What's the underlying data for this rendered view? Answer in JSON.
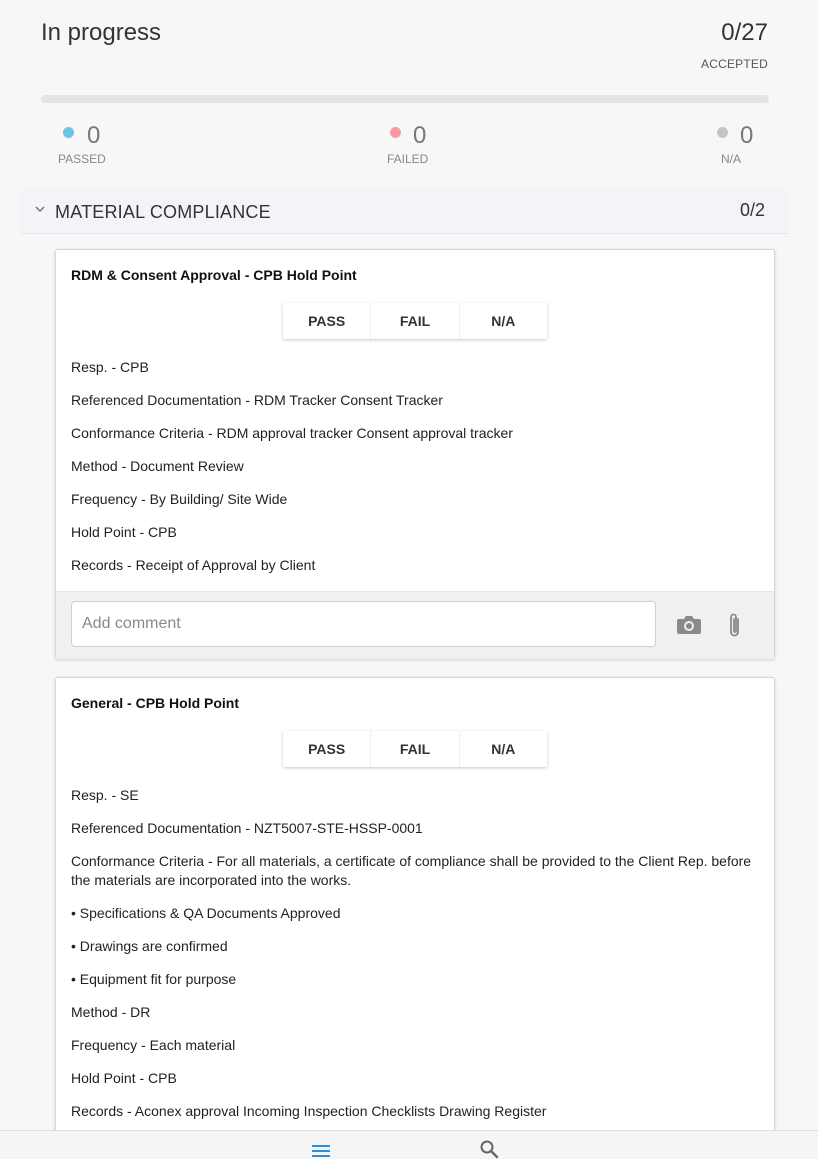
{
  "header": {
    "title": "In progress",
    "count": "0/27",
    "count_label": "ACCEPTED",
    "progress_fraction": 0
  },
  "stats": {
    "passed": {
      "value": "0",
      "label": "PASSED",
      "color": "#6cc3e8"
    },
    "failed": {
      "value": "0",
      "label": "FAILED",
      "color": "#f49aa3"
    },
    "na": {
      "value": "0",
      "label": "N/A",
      "color": "#c4c4c4"
    }
  },
  "section": {
    "title": "MATERIAL COMPLIANCE",
    "count": "0/2",
    "chevron_icon": "chevron-down-icon"
  },
  "buttons": {
    "pass": "PASS",
    "fail": "FAIL",
    "na": "N/A"
  },
  "cards": [
    {
      "title": "RDM & Consent Approval - CPB Hold Point",
      "lines": [
        "Resp. - CPB",
        "Referenced Documentation - RDM Tracker Consent Tracker",
        "Conformance Criteria - RDM approval tracker Consent approval tracker",
        "Method - Document Review",
        "Frequency - By Building/ Site Wide",
        "Hold Point - CPB",
        "Records - Receipt of Approval by Client"
      ],
      "comment_placeholder": "Add comment",
      "comment_value": ""
    },
    {
      "title": "General - CPB Hold Point",
      "lines": [
        "Resp. - SE",
        "Referenced Documentation - NZT5007-STE-HSSP-0001",
        "Conformance Criteria - For all materials, a certificate of compliance shall be provided to the Client Rep. before the materials are incorporated into the works.",
        "• Specifications & QA Documents Approved",
        "• Drawings are confirmed",
        "• Equipment fit for purpose",
        "Method - DR",
        "Frequency - Each material",
        "Hold Point - CPB",
        "Records - Aconex approval Incoming Inspection Checklists Drawing Register"
      ]
    }
  ],
  "bottom_nav": {
    "items": [
      {
        "icon": "menu-icon",
        "active": true,
        "color": "#2a8fd8"
      },
      {
        "icon": "search-icon",
        "active": false,
        "color": "#666666"
      }
    ]
  }
}
